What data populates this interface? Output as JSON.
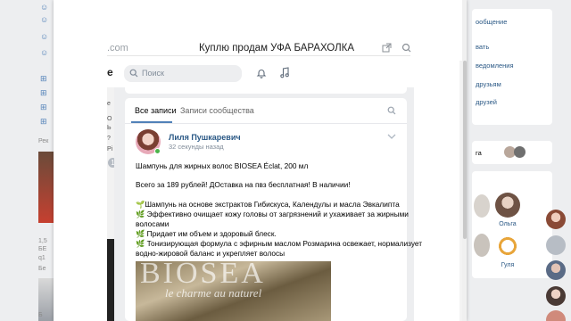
{
  "inner_browser": {
    "url_fragment": ".com",
    "title": "Куплю продам УФА БАРАХОЛКА"
  },
  "vk_header": {
    "logo_fragment": "e",
    "search_placeholder": "Поиск"
  },
  "inner_left": {
    "texts": [
      "е",
      "О",
      "Ь",
      "?",
      "Рі"
    ],
    "badge": "1"
  },
  "feed": {
    "tabs": [
      {
        "label": "Все записи",
        "active": true
      },
      {
        "label": "Записи сообщества",
        "active": false
      }
    ]
  },
  "post": {
    "author": "Лиля Пушкаревич",
    "time": "32 секунды назад",
    "lines": [
      "Шампунь для жирных волос BIOSEA Éclat, 200 мл",
      "",
      "Всего за 189 рублей! ДОставка на пвз бесплатная! В наличии!",
      "",
      "🌱Шампунь на основе экстрактов Гибискуса, Календулы и масла Эвкалипта",
      "🌿 Эффективно очищает кожу головы от загрязнений и ухаживает за жирными",
      "волосами",
      "🌿 Придает им объем и здоровый блеск.",
      "🌿 Тонизирующая формула с эфирным маслом Розмарина освежает, нормализует",
      "водно-жировой баланс и укрепляет волосы"
    ],
    "image_brand": "BIOSEA",
    "image_tagline": "le charme au naturel"
  },
  "right_page": {
    "links": [
      "ообщение",
      "вать",
      "ведомления",
      "друзьям",
      "друзей"
    ],
    "friends_label": "га",
    "friend_names": [
      "Ольга",
      "Гуля"
    ]
  },
  "left_page": {
    "texts": [
      "Рек",
      "1,5",
      "БЕ",
      "q1",
      "Бе",
      "Б"
    ]
  }
}
